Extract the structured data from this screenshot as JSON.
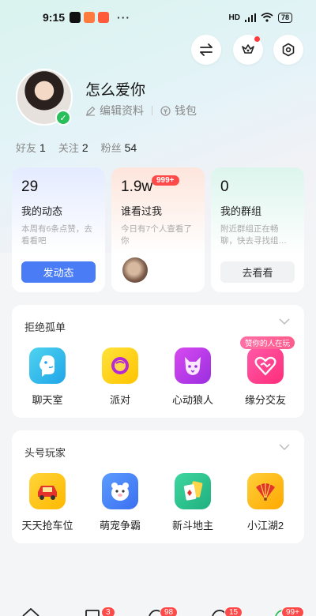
{
  "status_bar": {
    "time": "9:15",
    "network": "HD",
    "battery": "78"
  },
  "profile": {
    "username": "怎么爱你",
    "edit_label": "编辑资料",
    "wallet_label": "钱包",
    "stats": [
      {
        "label": "好友",
        "value": "1"
      },
      {
        "label": "关注",
        "value": "2"
      },
      {
        "label": "粉丝",
        "value": "54"
      }
    ]
  },
  "cards": [
    {
      "count": "29",
      "title": "我的动态",
      "desc": "本周有6条点赞，去看看吧",
      "button": "发动态"
    },
    {
      "count": "1.9w",
      "badge": "999+",
      "title": "谁看过我",
      "desc": "今日有7个人查看了你"
    },
    {
      "count": "0",
      "title": "我的群组",
      "desc": "附近群组正在畅聊，快去寻找组…",
      "button": "去看看"
    }
  ],
  "section_social": {
    "title": "拒绝孤单",
    "items": [
      {
        "label": "聊天室",
        "icon": "chat-room-icon"
      },
      {
        "label": "派对",
        "icon": "party-icon"
      },
      {
        "label": "心动狼人",
        "icon": "werewolf-icon"
      },
      {
        "label": "缘分交友",
        "icon": "heart-match-icon",
        "tag": "赞你的人在玩"
      }
    ]
  },
  "section_games": {
    "title": "头号玩家",
    "items": [
      {
        "label": "天天抢车位",
        "icon": "car-parking-icon"
      },
      {
        "label": "萌宠争霸",
        "icon": "pet-battle-icon"
      },
      {
        "label": "新斗地主",
        "icon": "poker-icon"
      },
      {
        "label": "小江湖2",
        "icon": "fan-icon"
      }
    ]
  },
  "tabbar": {
    "badges": [
      "3",
      "98",
      "15",
      "99+"
    ]
  },
  "colors": {
    "accent_blue": "#4a7df5",
    "badge_red": "#ff4a4a",
    "verified_green": "#2bbf5b"
  }
}
